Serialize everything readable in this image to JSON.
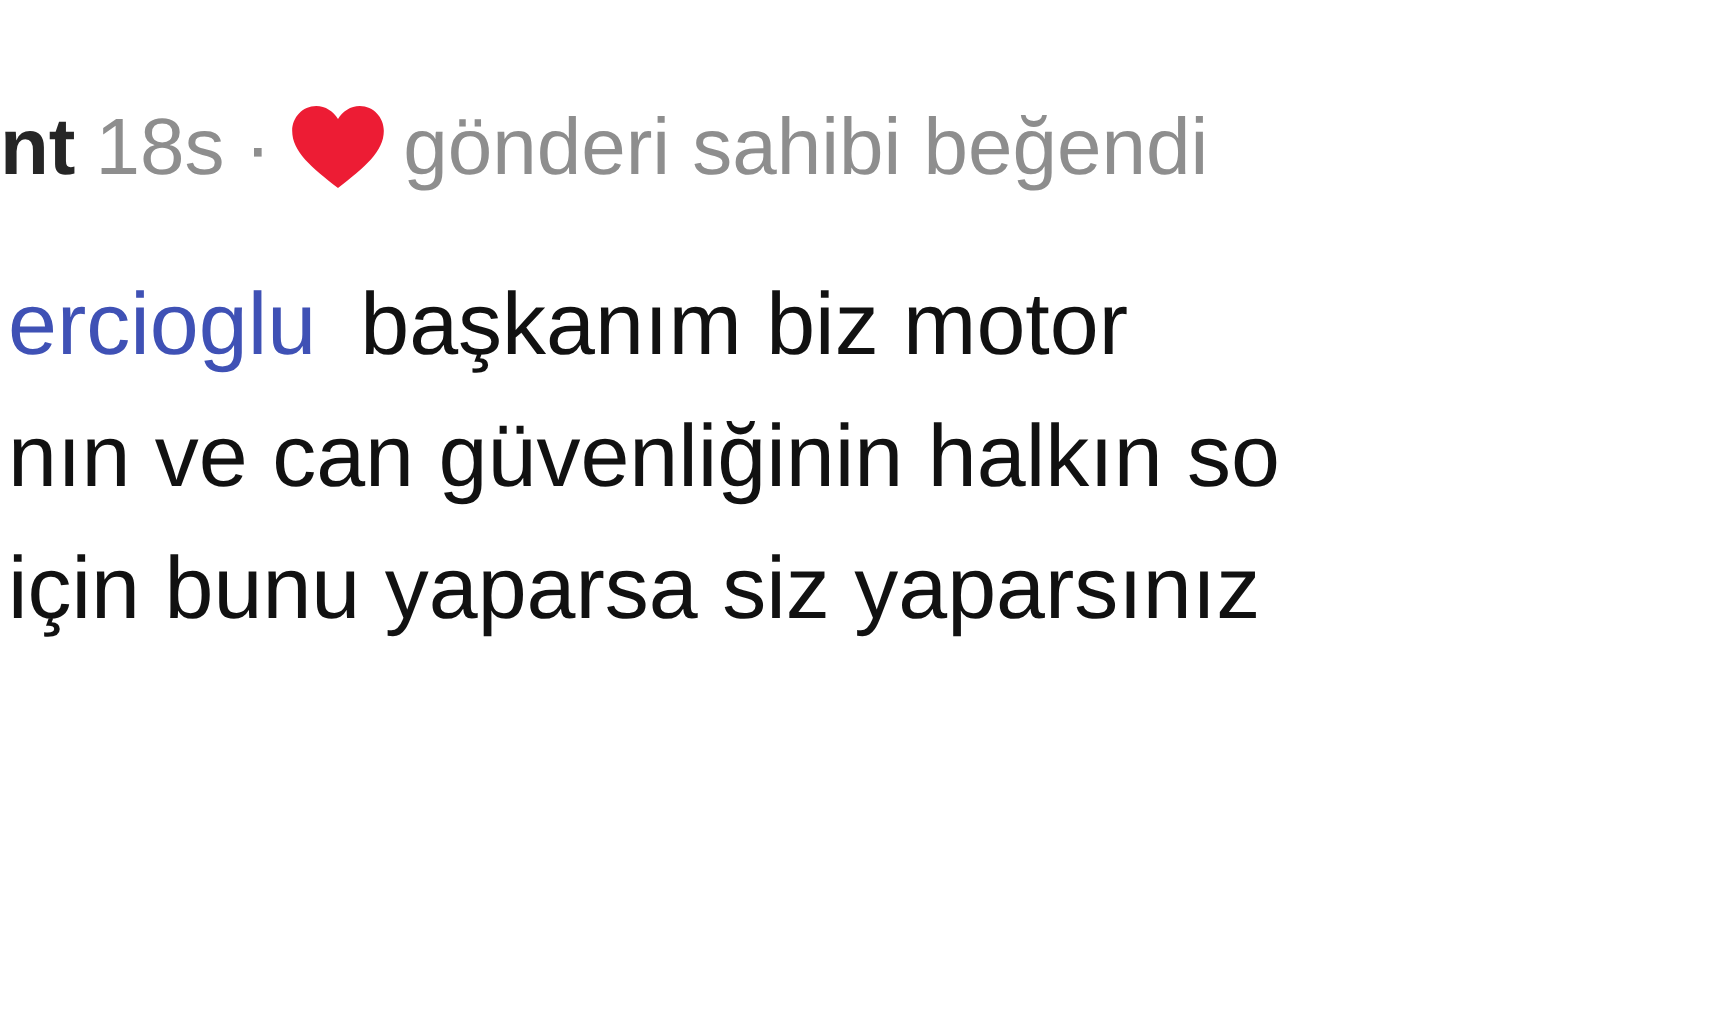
{
  "comment": {
    "username": "nt",
    "time": "18s",
    "separator": "·",
    "liked_by_author": true,
    "liked_label": "gönderi sahibi beğendi",
    "mention": "ercioglu",
    "body_lines": [
      "başkanım biz motor",
      "nın ve can güvenliğinin halkın so",
      "için bunu yaparsa siz yaparsınız"
    ]
  }
}
